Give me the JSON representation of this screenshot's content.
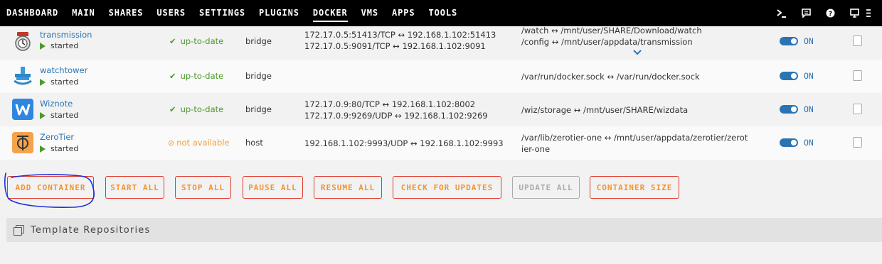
{
  "nav": {
    "items": [
      {
        "label": "DASHBOARD"
      },
      {
        "label": "MAIN"
      },
      {
        "label": "SHARES"
      },
      {
        "label": "USERS"
      },
      {
        "label": "SETTINGS"
      },
      {
        "label": "PLUGINS"
      },
      {
        "label": "DOCKER",
        "active": true
      },
      {
        "label": "VMS"
      },
      {
        "label": "APPS"
      },
      {
        "label": "TOOLS"
      }
    ],
    "icons": [
      "terminal-icon",
      "feedback-icon",
      "help-icon",
      "monitor-icon",
      "more-icon"
    ]
  },
  "containers": [
    {
      "name": "transmission",
      "status": "started",
      "update": "up-to-date",
      "network": "bridge",
      "ports": [
        "172.17.0.5:51413/TCP ↔ 192.168.1.102:51413",
        "172.17.0.5:9091/TCP ↔ 192.168.1.102:9091"
      ],
      "volumes": [
        "/watch ↔ /mnt/user/SHARE/Download/watch",
        "/config ↔ /mnt/user/appdata/transmission"
      ],
      "autostart": "ON",
      "icon": "transmission-icon"
    },
    {
      "name": "watchtower",
      "status": "started",
      "update": "up-to-date",
      "network": "bridge",
      "ports": [],
      "volumes": [
        "/var/run/docker.sock ↔ /var/run/docker.sock"
      ],
      "autostart": "ON",
      "icon": "watchtower-icon"
    },
    {
      "name": "Wiznote",
      "status": "started",
      "update": "up-to-date",
      "network": "bridge",
      "ports": [
        "172.17.0.9:80/TCP ↔ 192.168.1.102:8002",
        "172.17.0.9:9269/UDP ↔ 192.168.1.102:9269"
      ],
      "volumes": [
        "/wiz/storage ↔ /mnt/user/SHARE/wizdata"
      ],
      "autostart": "ON",
      "icon": "wiznote-icon"
    },
    {
      "name": "ZeroTier",
      "status": "started",
      "update": "not available",
      "network": "host",
      "ports": [
        "192.168.1.102:9993/UDP ↔ 192.168.1.102:9993"
      ],
      "volumes": [
        "/var/lib/zerotier-one ↔ /mnt/user/appdata/zerotier/zerot",
        "ier-one"
      ],
      "autostart": "ON",
      "icon": "zerotier-icon"
    }
  ],
  "buttons": {
    "add_container": "ADD CONTAINER",
    "start_all": "START ALL",
    "stop_all": "STOP ALL",
    "pause_all": "PAUSE ALL",
    "resume_all": "RESUME ALL",
    "check_updates": "CHECK FOR UPDATES",
    "update_all": "UPDATE ALL",
    "container_size": "CONTAINER SIZE"
  },
  "template_repos": {
    "title": "Template Repositories"
  },
  "colors": {
    "accent": "#f39330",
    "button_border": "#e03a2b",
    "link": "#2b74b3",
    "ok": "#4c9a2a",
    "warn": "#f0a030",
    "annotation": "#1f2fd8"
  }
}
